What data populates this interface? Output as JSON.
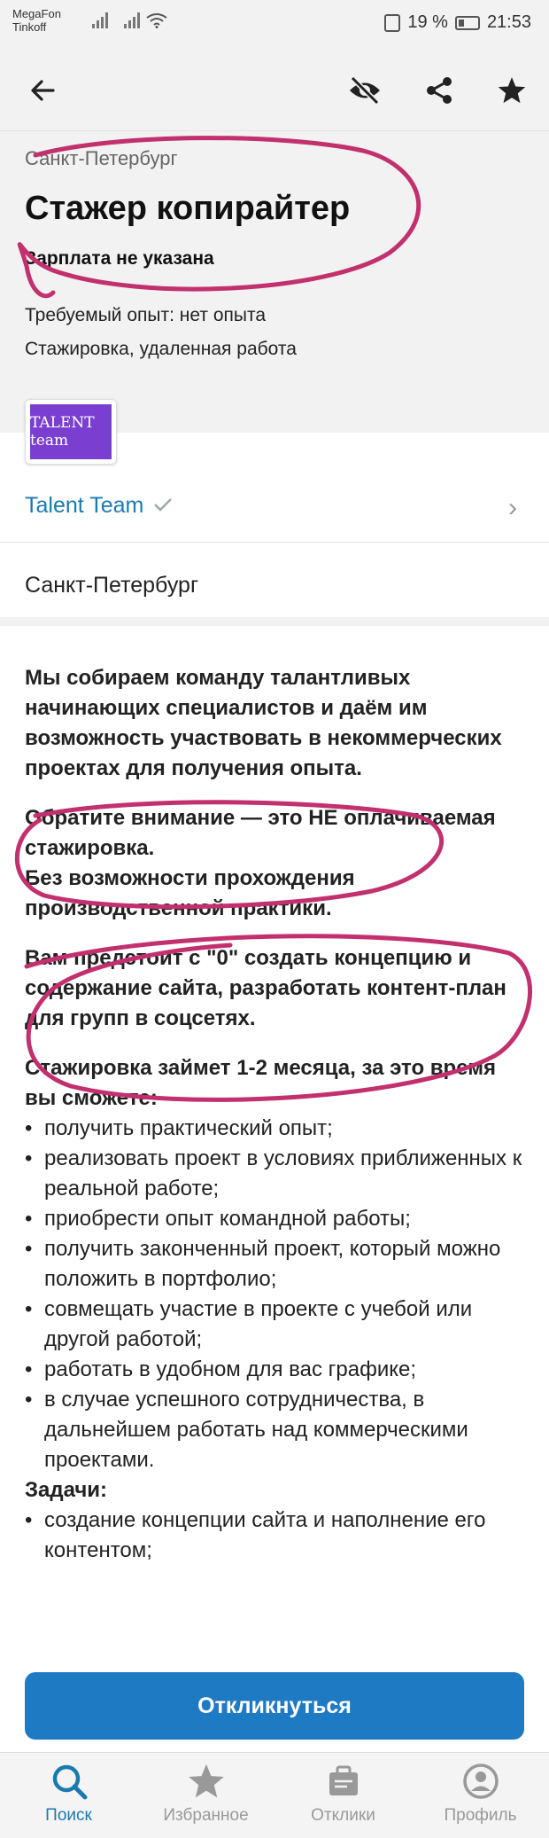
{
  "status_bar": {
    "carrier_1": "MegaFon",
    "carrier_2": "Tinkoff",
    "battery": "19 %",
    "time": "21:53"
  },
  "app_bar": {
    "back_icon": "arrow-left-icon",
    "hide_icon": "eye-off-icon",
    "share_icon": "share-icon",
    "favorite_icon": "star-icon"
  },
  "vacancy": {
    "city_header": "Санкт-Петербург",
    "title": "Стажер копирайтер",
    "salary": "Зарплата не указана",
    "experience": "Требуемый опыт: нет опыта",
    "employment": "Стажировка, удаленная работа",
    "company_logo_text": "TALENT team",
    "company_name": "Talent Team",
    "city": "Санкт-Петербург"
  },
  "description": {
    "p1": "Мы собираем команду талантливых начинающих специалистов и даём им возможность участвовать в некоммерческих проектах для получения опыта.",
    "p2": "Обратите внимание — это НЕ оплачиваемая стажировка.",
    "p3": "Без возможности прохождения производственной практики.",
    "p4": "Вам предстоит с \"0\" создать концепцию и содержание сайта, разработать контент-план для групп в соцсетях.",
    "p5": "Стажировка займет 1-2 месяца, за это время вы сможете:",
    "benefits": [
      "получить практический опыт;",
      "реализовать проект в условиях приближенных к реальной работе;",
      "приобрести опыт командной работы;",
      "получить законченный проект, который можно положить в портфолио;",
      "совмещать участие в проекте с учебой или другой работой;",
      "работать в удобном для вас графике;",
      "в случае успешного сотрудничества, в дальнейшем работать над коммерческими проектами."
    ],
    "tasks_heading": "Задачи:",
    "tasks": [
      "создание концепции сайта и наполнение его контентом;"
    ]
  },
  "apply_button": "Откликнуться",
  "bottom_nav": [
    {
      "label": "Поиск",
      "icon": "search-icon",
      "active": true
    },
    {
      "label": "Избранное",
      "icon": "star-icon",
      "active": false
    },
    {
      "label": "Отклики",
      "icon": "briefcase-icon",
      "active": false
    },
    {
      "label": "Профиль",
      "icon": "profile-icon",
      "active": false
    }
  ],
  "colors": {
    "accent": "#1f7ac4",
    "link": "#1a7ab0",
    "annotation": "#c2306e"
  }
}
